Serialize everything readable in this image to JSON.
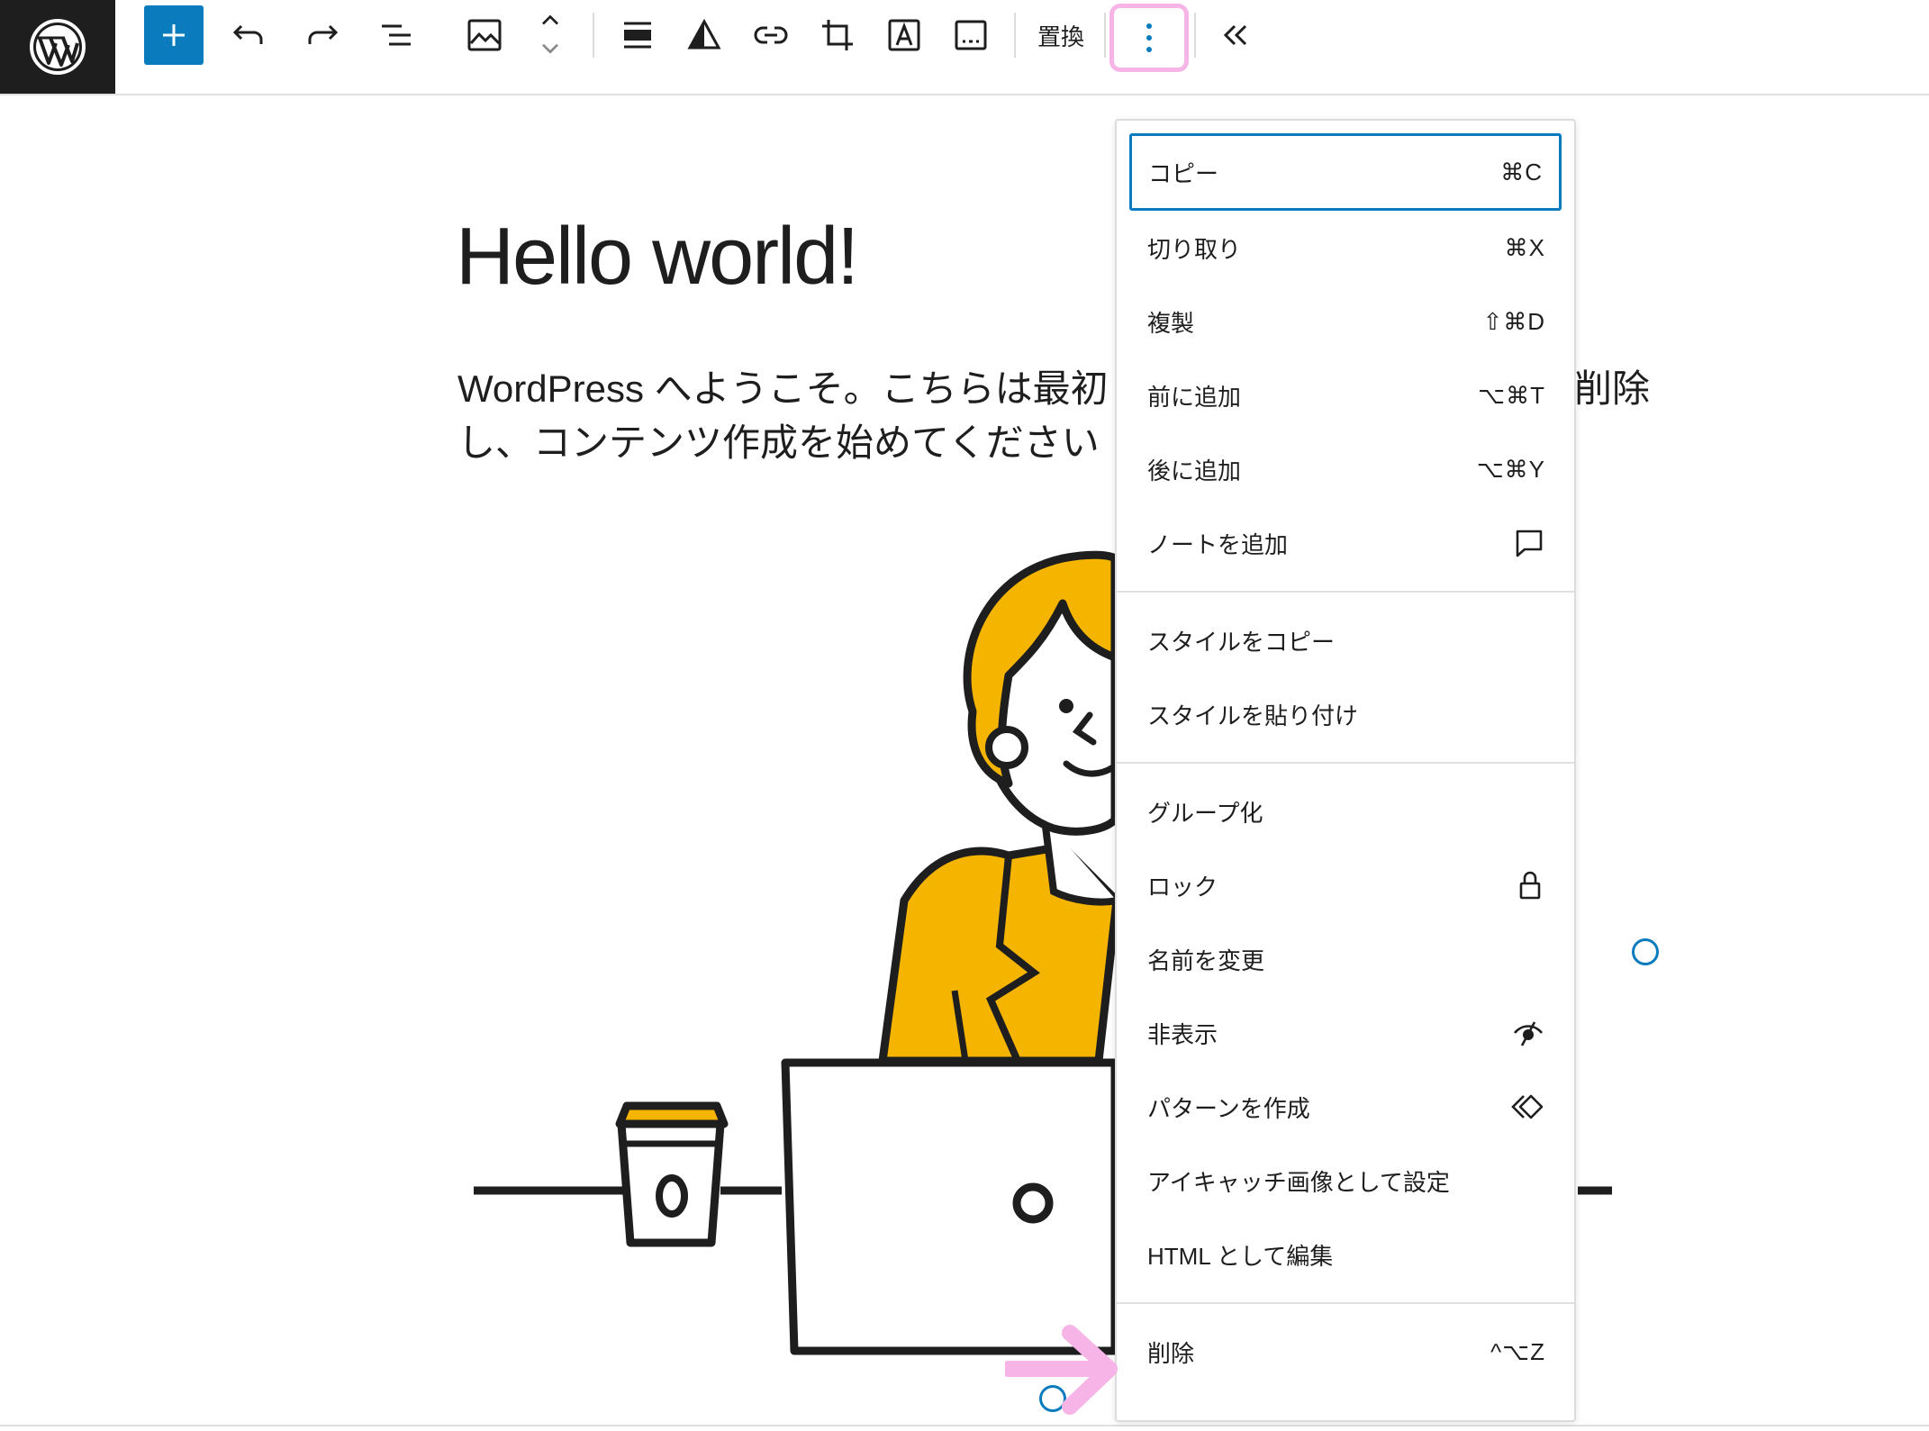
{
  "toolbar": {
    "items": [
      {
        "name": "wordpress-logo"
      },
      {
        "name": "add-block-button",
        "icon": "plus-icon"
      },
      {
        "name": "undo-button",
        "icon": "undo-icon"
      },
      {
        "name": "redo-button",
        "icon": "redo-icon"
      },
      {
        "name": "document-overview-button",
        "icon": "list-view-icon"
      },
      {
        "name": "block-type-button",
        "icon": "image-icon"
      },
      {
        "name": "move-up-down-buttons",
        "icon": "chevron-up-down-icon"
      },
      {
        "name": "align-button",
        "icon": "align-wide-icon"
      },
      {
        "name": "duotone-button",
        "icon": "duotone-icon"
      },
      {
        "name": "link-button",
        "icon": "link-icon"
      },
      {
        "name": "crop-button",
        "icon": "crop-icon"
      },
      {
        "name": "text-overlay-button",
        "icon": "text-over-image-icon"
      },
      {
        "name": "caption-button",
        "icon": "caption-icon"
      }
    ],
    "replace_label": "置換",
    "accent_color": "#0a7bbd",
    "highlight_color": "#f7b4e6"
  },
  "post": {
    "title": "Hello world!",
    "paragraph_line1": "WordPress へようこそ。こちらは最初",
    "paragraph_line1_tail": "削除",
    "paragraph_line2": "し、コンテンツ作成を始めてください"
  },
  "menu": {
    "group1": [
      {
        "label": "コピー",
        "shortcut": "⌘C"
      },
      {
        "label": "切り取り",
        "shortcut": "⌘X"
      },
      {
        "label": "複製",
        "shortcut": "⇧⌘D"
      },
      {
        "label": "前に追加",
        "shortcut": "⌥⌘T"
      },
      {
        "label": "後に追加",
        "shortcut": "⌥⌘Y"
      },
      {
        "label": "ノートを追加",
        "icon": "comment-icon"
      }
    ],
    "group2": [
      {
        "label": "スタイルをコピー"
      },
      {
        "label": "スタイルを貼り付け"
      }
    ],
    "group3": [
      {
        "label": "グループ化"
      },
      {
        "label": "ロック",
        "icon": "lock-icon"
      },
      {
        "label": "名前を変更"
      },
      {
        "label": "非表示",
        "icon": "hidden-eye-icon"
      },
      {
        "label": "パターンを作成",
        "icon": "symbol-icon"
      },
      {
        "label": "アイキャッチ画像として設定"
      },
      {
        "label": "HTML として編集"
      }
    ],
    "group4": [
      {
        "label": "削除",
        "shortcut": "^⌥Z"
      }
    ]
  }
}
